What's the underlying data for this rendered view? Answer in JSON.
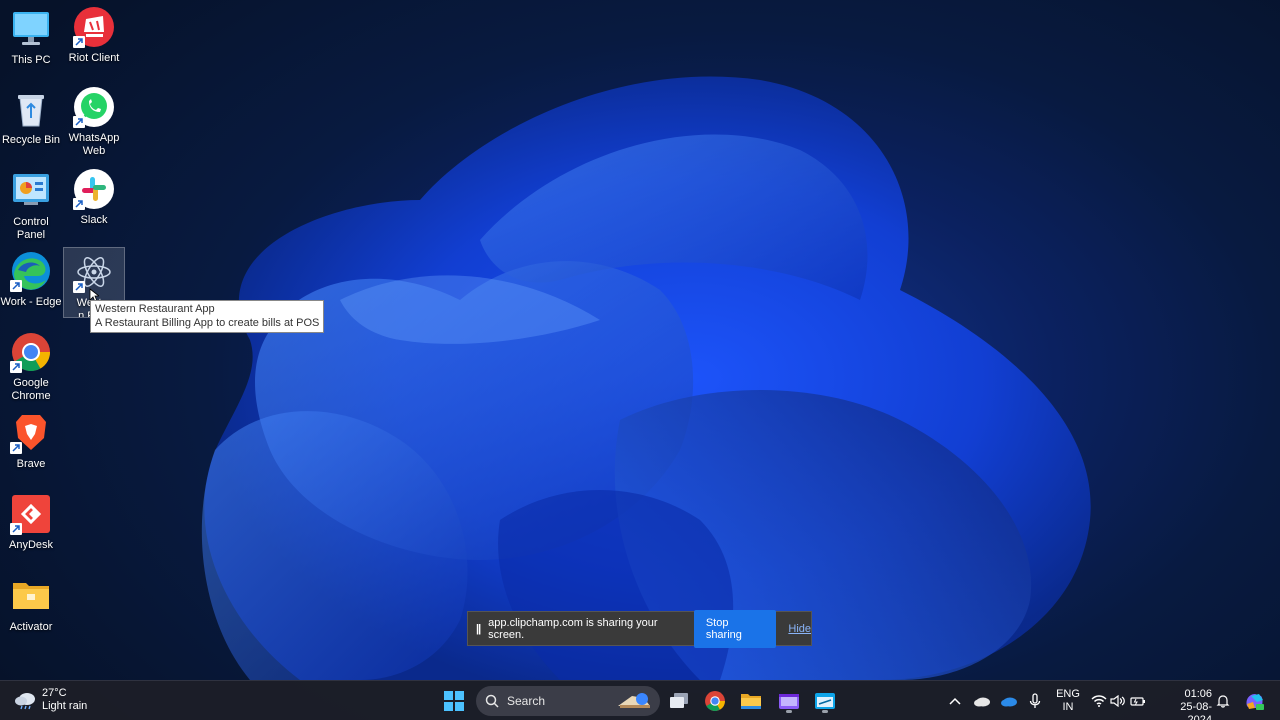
{
  "desktop": {
    "icons": [
      {
        "label": "This PC"
      },
      {
        "label": "Riot Client"
      },
      {
        "label": "Recycle Bin"
      },
      {
        "label": "WhatsApp Web"
      },
      {
        "label": "Control Panel"
      },
      {
        "label": "Slack"
      },
      {
        "label": "Work - Edge"
      },
      {
        "label": "Western Restaurant App",
        "visible_label": "Western Rest"
      },
      {
        "label": "Google Chrome"
      },
      {
        "label": "Brave"
      },
      {
        "label": "AnyDesk"
      },
      {
        "label": "Activator"
      }
    ],
    "tooltip": {
      "title": "Western Restaurant App",
      "description": "A Restaurant Billing App to create bills at POS"
    }
  },
  "share_bar": {
    "pause_glyph": "||",
    "message": "app.clipchamp.com is sharing your screen.",
    "stop_label": "Stop sharing",
    "hide_label": "Hide"
  },
  "taskbar": {
    "weather": {
      "temp": "27°C",
      "condition": "Light rain"
    },
    "search_placeholder": "Search",
    "apps": [
      "start-icon",
      "search-icon",
      "task-view-icon",
      "chrome-icon",
      "file-explorer-icon",
      "clipchamp-icon",
      "whiteboard-icon"
    ],
    "tray": {
      "lang_line1": "ENG",
      "lang_line2": "IN",
      "time": "01:06",
      "date": "25-08-2024"
    }
  },
  "colors": {
    "accent": "#1a73e8",
    "wallpaper_blue": "#1f5fff",
    "taskbar_bg": "#1c1e28"
  }
}
